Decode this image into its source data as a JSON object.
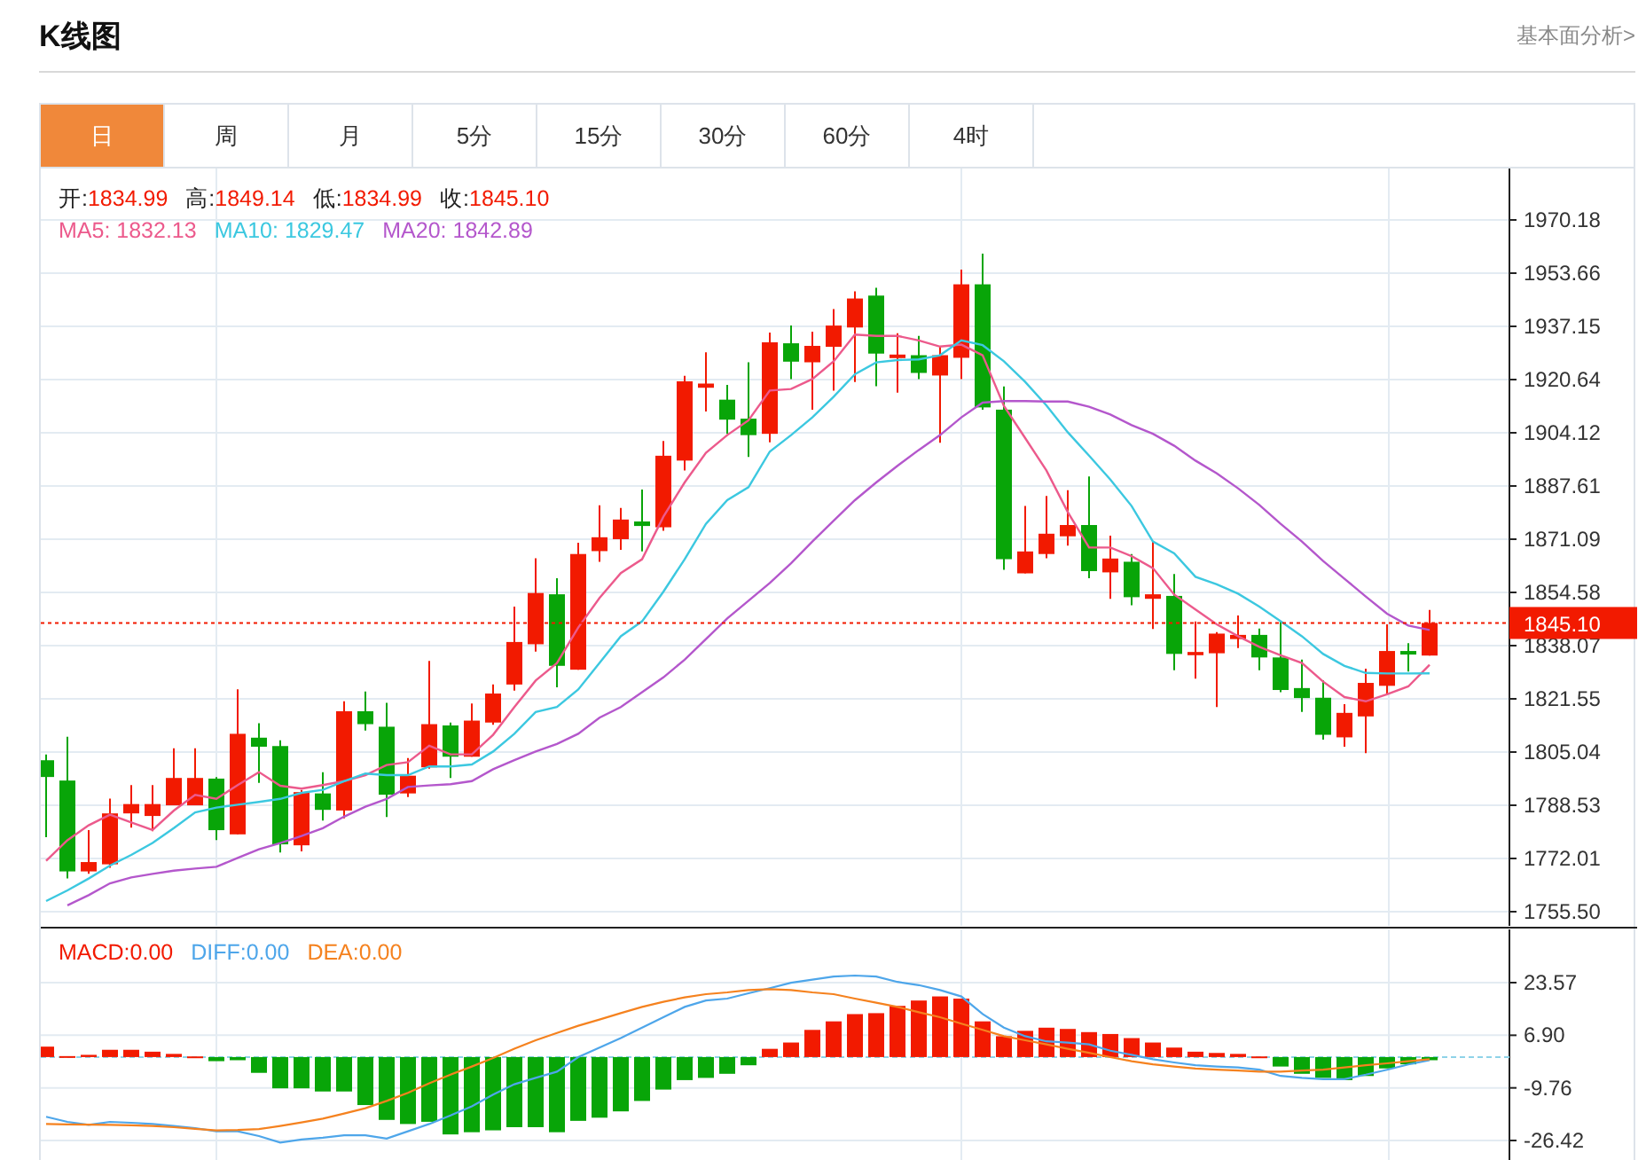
{
  "header": {
    "title": "K线图",
    "link": "基本面分析>"
  },
  "tabs": [
    {
      "label": "日",
      "selected": true
    },
    {
      "label": "周",
      "selected": false
    },
    {
      "label": "月",
      "selected": false
    },
    {
      "label": "5分",
      "selected": false
    },
    {
      "label": "15分",
      "selected": false
    },
    {
      "label": "30分",
      "selected": false
    },
    {
      "label": "60分",
      "selected": false
    },
    {
      "label": "4时",
      "selected": false
    }
  ],
  "ohlc_legend": [
    {
      "label": "开:",
      "value": "1834.99"
    },
    {
      "label": "高:",
      "value": "1849.14"
    },
    {
      "label": "低:",
      "value": "1834.99"
    },
    {
      "label": "收:",
      "value": "1845.10"
    }
  ],
  "ma_legend_values": [
    "1832.13",
    "1829.47",
    "1842.89"
  ],
  "chart_data": {
    "type": "candlestick",
    "ylim": [
      1755.5,
      1970.18
    ],
    "grid": true,
    "yticks": [
      1970.18,
      1953.66,
      1937.15,
      1920.64,
      1904.12,
      1887.61,
      1871.09,
      1854.58,
      1838.07,
      1821.55,
      1805.04,
      1788.53,
      1772.01,
      {
        "value": 1755.5,
        "label": "1755.50"
      }
    ],
    "ref_lines": [
      {
        "axis": "y",
        "value": 1845.1,
        "label": "1845.10",
        "color": "#f21a00"
      }
    ],
    "series": [
      {
        "name": "MA5:",
        "type": "line",
        "color": "#ec5a8c",
        "values": [
          1771.3,
          1777.7,
          1782.3,
          1785.6,
          1783.2,
          1780.8,
          1786.9,
          1791.8,
          1790.5,
          1794.8,
          1798.8,
          1794.6,
          1793.7,
          1794.8,
          1796.0,
          1797.9,
          1801.0,
          1801.9,
          1807.0,
          1804.3,
          1804.3,
          1810.4,
          1819.0,
          1827.2,
          1832.7,
          1843.7,
          1852.9,
          1860.6,
          1864.9,
          1878.1,
          1888.7,
          1897.9,
          1903.4,
          1908.0,
          1917.2,
          1917.7,
          1920.8,
          1926.3,
          1934.6,
          1934.2,
          1934.2,
          1932.8,
          1930.9,
          1931.5,
          1928.2,
          1912.5,
          1902.5,
          1892.4,
          1879.5,
          1868.5,
          1868.5,
          1865.8,
          1862.1,
          1853.9,
          1849.3,
          1844.7,
          1841.0,
          1837.7,
          1835.1,
          1832.7,
          1826.9,
          1822.1,
          1820.8,
          1823.0,
          1825.4,
          1832.1
        ]
      },
      {
        "name": "MA10:",
        "type": "line",
        "color": "#3cc8e0",
        "values": [
          1758.8,
          1762.1,
          1765.8,
          1769.8,
          1773.1,
          1776.8,
          1781.4,
          1786.3,
          1787.8,
          1788.7,
          1789.6,
          1790.5,
          1792.4,
          1793.3,
          1796.0,
          1798.4,
          1797.9,
          1797.9,
          1800.6,
          1800.6,
          1801.2,
          1805.2,
          1810.7,
          1817.5,
          1819.0,
          1824.5,
          1832.7,
          1841.0,
          1845.6,
          1854.8,
          1864.9,
          1875.9,
          1883.2,
          1887.2,
          1898.3,
          1903.4,
          1908.9,
          1915.3,
          1922.3,
          1926.0,
          1926.7,
          1926.9,
          1928.2,
          1932.8,
          1931.3,
          1926.3,
          1919.9,
          1912.6,
          1904.3,
          1897.0,
          1889.6,
          1881.4,
          1870.4,
          1866.7,
          1859.4,
          1857.1,
          1854.2,
          1850.2,
          1845.6,
          1841.0,
          1835.5,
          1831.8,
          1829.6,
          1829.4,
          1829.4,
          1829.5
        ]
      },
      {
        "name": "MA20:",
        "type": "line",
        "color": "#b457cc",
        "values": [
          null,
          1757.5,
          1760.6,
          1764.3,
          1766.1,
          1767.2,
          1768.2,
          1768.9,
          1769.4,
          1772.2,
          1774.9,
          1776.8,
          1779.0,
          1781.4,
          1785.0,
          1788.1,
          1790.5,
          1794.2,
          1794.7,
          1795.1,
          1796.0,
          1799.7,
          1802.5,
          1805.2,
          1807.6,
          1810.7,
          1815.7,
          1819.0,
          1823.6,
          1828.2,
          1833.7,
          1840.1,
          1846.5,
          1852.0,
          1857.5,
          1863.6,
          1870.4,
          1876.8,
          1883.2,
          1888.7,
          1893.9,
          1898.8,
          1903.4,
          1908.9,
          1913.5,
          1914.0,
          1914.0,
          1913.8,
          1913.8,
          1912.2,
          1909.8,
          1906.5,
          1903.8,
          1900.1,
          1895.5,
          1891.5,
          1886.9,
          1881.7,
          1875.9,
          1870.4,
          1864.3,
          1858.8,
          1853.3,
          1848.0,
          1844.3,
          1842.9
        ]
      }
    ],
    "ohlc": [
      [
        1802.5,
        1804.3,
        1778.6,
        1797.3
      ],
      [
        1796.2,
        1809.8,
        1765.8,
        1768.0
      ],
      [
        1768.0,
        1780.8,
        1767.3,
        1770.9
      ],
      [
        1770.2,
        1790.6,
        1769.1,
        1786.0
      ],
      [
        1786.0,
        1794.8,
        1781.6,
        1788.9
      ],
      [
        1785.2,
        1794.8,
        1780.5,
        1788.9
      ],
      [
        1788.5,
        1806.2,
        1788.5,
        1797.0
      ],
      [
        1788.5,
        1806.2,
        1788.5,
        1797.0
      ],
      [
        1796.8,
        1797.3,
        1777.7,
        1780.8
      ],
      [
        1779.5,
        1824.5,
        1779.5,
        1810.7
      ],
      [
        1809.5,
        1814.0,
        1795.5,
        1806.7
      ],
      [
        1806.9,
        1808.7,
        1773.9,
        1776.4
      ],
      [
        1776.1,
        1793.3,
        1774.2,
        1792.6
      ],
      [
        1792.2,
        1798.8,
        1783.8,
        1787.1
      ],
      [
        1786.9,
        1820.8,
        1784.5,
        1817.7
      ],
      [
        1817.7,
        1823.8,
        1811.7,
        1813.7
      ],
      [
        1812.9,
        1820.3,
        1784.9,
        1791.8
      ],
      [
        1792.2,
        1803.2,
        1791.1,
        1797.7
      ],
      [
        1800.3,
        1833.3,
        1799.9,
        1813.7
      ],
      [
        1813.3,
        1814.2,
        1797.0,
        1803.6
      ],
      [
        1803.6,
        1820.1,
        1803.6,
        1814.8
      ],
      [
        1814.2,
        1826.0,
        1813.5,
        1823.2
      ],
      [
        1826.0,
        1850.2,
        1824.1,
        1839.2
      ],
      [
        1838.5,
        1865.2,
        1836.2,
        1854.4
      ],
      [
        1854.0,
        1859.0,
        1825.1,
        1831.8
      ],
      [
        1830.6,
        1870.0,
        1830.6,
        1866.5
      ],
      [
        1867.4,
        1881.6,
        1864.1,
        1871.7
      ],
      [
        1871.1,
        1880.8,
        1867.8,
        1877.2
      ],
      [
        1876.6,
        1886.5,
        1867.3,
        1875.2
      ],
      [
        1874.8,
        1901.6,
        1873.7,
        1897.0
      ],
      [
        1895.5,
        1921.8,
        1892.4,
        1920.1
      ],
      [
        1918.1,
        1929.1,
        1910.7,
        1919.4
      ],
      [
        1914.4,
        1919.0,
        1903.8,
        1908.2
      ],
      [
        1908.5,
        1926.0,
        1896.6,
        1903.4
      ],
      [
        1903.8,
        1935.2,
        1901.2,
        1932.2
      ],
      [
        1931.9,
        1937.4,
        1920.8,
        1926.2
      ],
      [
        1926.0,
        1935.5,
        1911.3,
        1931.1
      ],
      [
        1930.8,
        1942.5,
        1917.2,
        1937.4
      ],
      [
        1936.8,
        1948.0,
        1919.9,
        1945.8
      ],
      [
        1946.7,
        1949.1,
        1918.6,
        1928.7
      ],
      [
        1927.3,
        1935.0,
        1916.6,
        1928.4
      ],
      [
        1928.2,
        1934.2,
        1920.8,
        1922.7
      ],
      [
        1921.9,
        1930.9,
        1901.0,
        1928.2
      ],
      [
        1927.4,
        1954.8,
        1920.8,
        1950.2
      ],
      [
        1950.2,
        1959.7,
        1911.3,
        1912.0
      ],
      [
        1911.3,
        1918.5,
        1861.6,
        1864.9
      ],
      [
        1860.5,
        1881.4,
        1860.5,
        1867.3
      ],
      [
        1866.5,
        1884.5,
        1865.2,
        1872.8
      ],
      [
        1872.0,
        1886.3,
        1869.1,
        1875.5
      ],
      [
        1875.5,
        1890.6,
        1859.0,
        1861.2
      ],
      [
        1860.8,
        1872.2,
        1852.6,
        1865.1
      ],
      [
        1864.1,
        1866.5,
        1850.6,
        1853.1
      ],
      [
        1852.6,
        1870.4,
        1843.2,
        1854.0
      ],
      [
        1853.5,
        1860.3,
        1830.4,
        1835.5
      ],
      [
        1835.1,
        1845.6,
        1827.8,
        1836.1
      ],
      [
        1835.7,
        1842.3,
        1819.0,
        1841.8
      ],
      [
        1840.1,
        1847.4,
        1837.3,
        1841.4
      ],
      [
        1841.4,
        1843.4,
        1830.4,
        1834.4
      ],
      [
        1834.4,
        1845.6,
        1823.6,
        1824.3
      ],
      [
        1824.9,
        1833.7,
        1817.5,
        1821.8
      ],
      [
        1821.9,
        1827.3,
        1808.9,
        1810.4
      ],
      [
        1809.6,
        1819.9,
        1806.7,
        1817.2
      ],
      [
        1816.1,
        1830.9,
        1804.7,
        1826.5
      ],
      [
        1825.6,
        1844.7,
        1823.0,
        1836.4
      ],
      [
        1836.4,
        1838.8,
        1830.0,
        1835.3
      ],
      [
        1834.99,
        1849.14,
        1834.99,
        1845.1
      ]
    ]
  },
  "macd_panel": {
    "legend_values": [
      "0.00",
      "0.00",
      "0.00"
    ],
    "chart_data": {
      "type": "bar",
      "grid": true,
      "ylim": [
        -33.72,
        41.54
      ],
      "ref_lines": [
        {
          "axis": "y",
          "value": 0,
          "color": "#8fd3e8"
        }
      ],
      "yticks": [
        {
          "value": 23.57,
          "label": "23.57"
        },
        {
          "value": 6.9,
          "label": "6.90"
        },
        {
          "value": -9.76,
          "label": "-9.76"
        },
        {
          "value": -26.42,
          "label": "-26.42"
        }
      ],
      "series": [
        {
          "name": "MACD:",
          "type": "bar",
          "color": "#f21a00",
          "values": [
            3.3,
            0.3,
            0.7,
            2.3,
            2.3,
            1.7,
            1.0,
            0.2,
            null,
            null,
            null,
            null,
            null,
            null,
            null,
            null,
            null,
            null,
            null,
            null,
            null,
            null,
            null,
            null,
            null,
            null,
            null,
            null,
            null,
            null,
            null,
            null,
            null,
            null,
            2.6,
            4.6,
            8.6,
            11.3,
            13.6,
            13.9,
            16.2,
            17.9,
            19.2,
            18.5,
            11.3,
            6.6,
            8.3,
            9.3,
            8.9,
            7.9,
            7.3,
            6.0,
            4.6,
            3.0,
            1.7,
            1.3,
            1.0,
            0.2,
            null,
            null,
            null,
            null,
            null,
            null,
            null,
            null
          ]
        },
        {
          "type": "bar",
          "color": "#08a508",
          "values": [
            null,
            null,
            null,
            null,
            null,
            null,
            null,
            null,
            -1.3,
            -1.0,
            -5.0,
            -9.9,
            -9.9,
            -10.9,
            -10.9,
            -15.2,
            -19.9,
            -21.2,
            -20.5,
            -24.5,
            -23.8,
            -23.2,
            -22.2,
            -22.2,
            -23.8,
            -20.2,
            -19.2,
            -17.2,
            -13.9,
            -10.3,
            -7.3,
            -6.6,
            -5.3,
            -2.6,
            null,
            null,
            null,
            null,
            null,
            null,
            null,
            null,
            null,
            null,
            null,
            null,
            null,
            null,
            null,
            null,
            null,
            null,
            null,
            null,
            null,
            null,
            null,
            null,
            -3.0,
            -5.3,
            -6.6,
            -7.3,
            -6.0,
            -3.6,
            -2.3,
            -1.0
          ]
        },
        {
          "name": "DIFF:",
          "type": "line",
          "color": "#4ea6ea",
          "values": [
            -18.9,
            -20.5,
            -21.5,
            -20.5,
            -20.8,
            -21.2,
            -21.8,
            -22.5,
            -23.5,
            -23.5,
            -25.0,
            -27.1,
            -26.1,
            -25.5,
            -24.8,
            -24.8,
            -25.8,
            -23.5,
            -21.2,
            -18.5,
            -15.6,
            -11.9,
            -8.6,
            -6.6,
            -4.6,
            0.0,
            3.0,
            6.0,
            9.3,
            12.6,
            15.9,
            17.9,
            18.5,
            20.2,
            21.8,
            23.5,
            24.5,
            25.5,
            25.8,
            25.5,
            23.8,
            22.8,
            21.2,
            19.2,
            13.6,
            9.3,
            6.6,
            5.0,
            4.6,
            4.0,
            2.0,
            0.7,
            -0.7,
            -1.7,
            -2.6,
            -3.0,
            -3.3,
            -4.0,
            -6.0,
            -6.6,
            -7.0,
            -7.0,
            -5.6,
            -4.0,
            -2.3,
            -1.0
          ]
        },
        {
          "name": "DEA:",
          "type": "line",
          "color": "#f5821f",
          "values": [
            -21.2,
            -21.3,
            -21.4,
            -21.5,
            -21.6,
            -21.8,
            -22.2,
            -22.7,
            -23.2,
            -23.1,
            -22.8,
            -21.8,
            -20.7,
            -19.5,
            -17.9,
            -16.2,
            -13.9,
            -11.3,
            -8.3,
            -5.6,
            -3.0,
            -0.3,
            2.6,
            5.3,
            7.6,
            9.9,
            11.9,
            13.9,
            15.9,
            17.5,
            18.9,
            19.9,
            20.5,
            21.2,
            21.5,
            21.2,
            20.5,
            19.9,
            18.5,
            17.2,
            15.9,
            14.2,
            12.6,
            10.6,
            8.6,
            6.6,
            5.3,
            4.0,
            2.6,
            1.3,
            0.0,
            -1.3,
            -2.3,
            -3.0,
            -3.6,
            -4.0,
            -4.3,
            -4.6,
            -4.6,
            -4.3,
            -4.0,
            -3.3,
            -2.6,
            -2.0,
            -1.3,
            -0.7
          ]
        }
      ]
    }
  }
}
